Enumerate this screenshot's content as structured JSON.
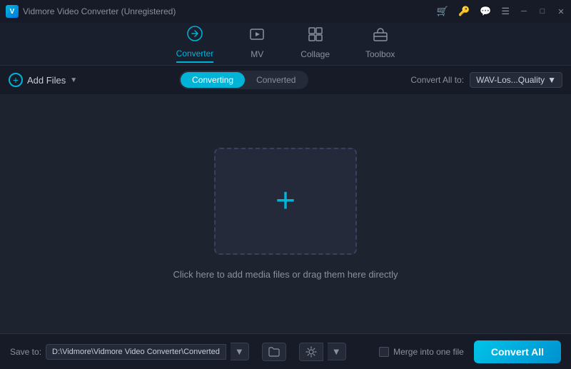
{
  "titlebar": {
    "app_name": "Vidmore Video Converter (Unregistered)",
    "logo_text": "V"
  },
  "nav": {
    "tabs": [
      {
        "id": "converter",
        "label": "Converter",
        "icon": "🔄",
        "active": true
      },
      {
        "id": "mv",
        "label": "MV",
        "icon": "🎬",
        "active": false
      },
      {
        "id": "collage",
        "label": "Collage",
        "icon": "⊞",
        "active": false
      },
      {
        "id": "toolbox",
        "label": "Toolbox",
        "icon": "🧰",
        "active": false
      }
    ]
  },
  "sub_header": {
    "add_files_label": "Add Files",
    "converting_tab": "Converting",
    "converted_tab": "Converted",
    "convert_all_to_label": "Convert All to:",
    "format_value": "WAV-Los...Quality"
  },
  "main": {
    "drop_text": "Click here to add media files or drag them here directly"
  },
  "footer": {
    "save_to_label": "Save to:",
    "save_path": "D:\\Vidmore\\Vidmore Video Converter\\Converted",
    "merge_label": "Merge into one file",
    "convert_all_label": "Convert All"
  }
}
